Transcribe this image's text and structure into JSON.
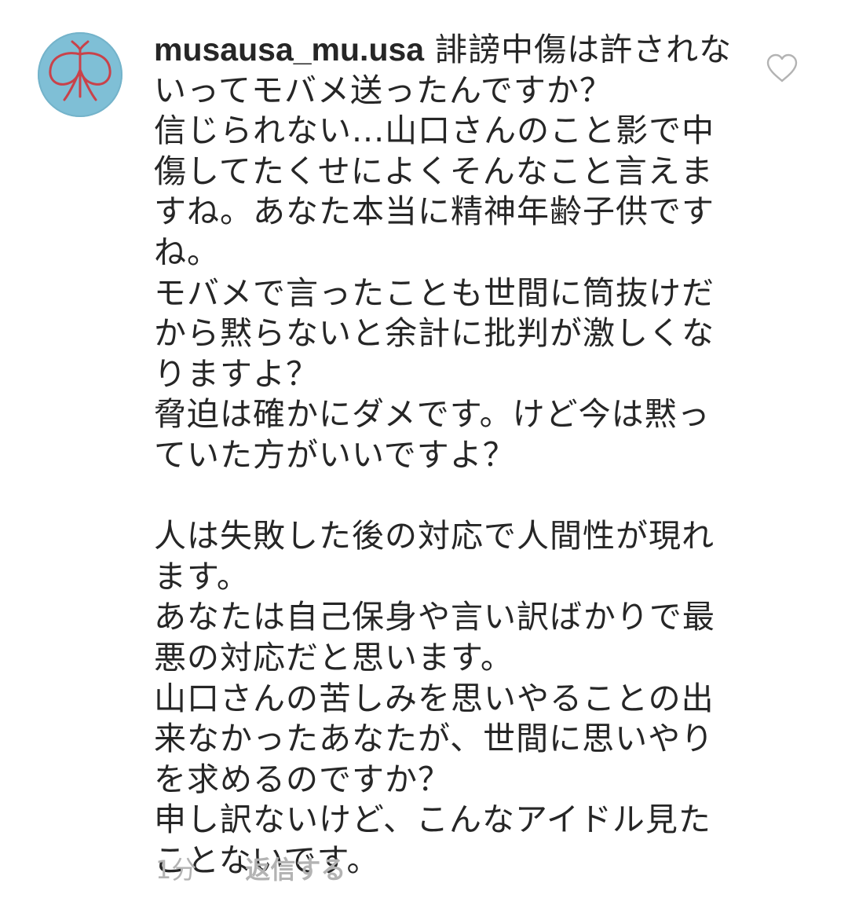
{
  "comment": {
    "username": "musausa_mu.usa",
    "text": "誹謗中傷は許されないってモバメ送ったんですか？\n信じられない...山口さんのこと影で中傷してたくせによくそんなこと言えますね。あなた本当に精神年齢子供ですね。\nモバメで言ったことも世間に筒抜けだから黙らないと余計に批判が激しくなりますよ？\n脅迫は確かにダメです。けど今は黙っていた方がいいですよ？\n\n人は失敗した後の対応で人間性が現れます。\nあなたは自己保身や言い訳ばかりで最悪の対応だと思います。\n山口さんの苦しみを思いやることの出来なかったあなたが、世間に思いやりを求めるのですか？\n申し訳ないけど、こんなアイドル見たことないです。",
    "timestamp": "1分",
    "reply_label": "返信する",
    "avatar_icon": "butterfly-avatar-icon",
    "like_icon": "heart-outline-icon"
  },
  "colors": {
    "text": "#262626",
    "meta": "#b3b3b3",
    "avatar_bg": "#7fbfd6",
    "avatar_motif": "#c9424a"
  }
}
